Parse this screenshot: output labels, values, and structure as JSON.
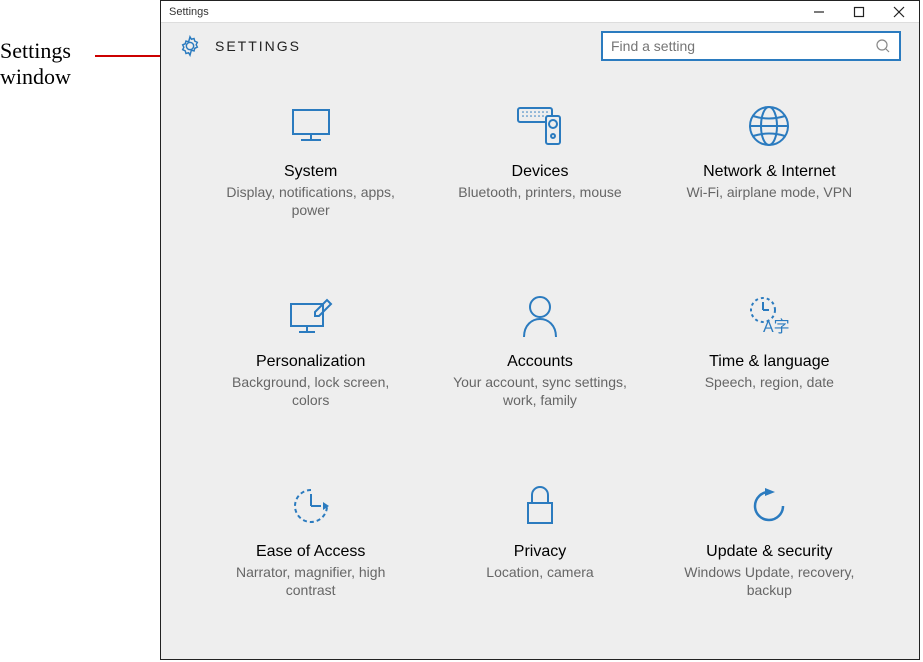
{
  "annotation": {
    "line1": "Settings",
    "line2": "window"
  },
  "titlebar": {
    "title": "Settings"
  },
  "header": {
    "title": "SETTINGS"
  },
  "search": {
    "placeholder": "Find a setting"
  },
  "accent_color": "#2b7bbf",
  "tiles": [
    {
      "title": "System",
      "desc": "Display, notifications, apps, power"
    },
    {
      "title": "Devices",
      "desc": "Bluetooth, printers, mouse"
    },
    {
      "title": "Network & Internet",
      "desc": "Wi-Fi, airplane mode, VPN"
    },
    {
      "title": "Personalization",
      "desc": "Background, lock screen, colors"
    },
    {
      "title": "Accounts",
      "desc": "Your account, sync settings, work, family"
    },
    {
      "title": "Time & language",
      "desc": "Speech, region, date"
    },
    {
      "title": "Ease of Access",
      "desc": "Narrator, magnifier, high contrast"
    },
    {
      "title": "Privacy",
      "desc": "Location, camera"
    },
    {
      "title": "Update & security",
      "desc": "Windows Update, recovery, backup"
    }
  ]
}
